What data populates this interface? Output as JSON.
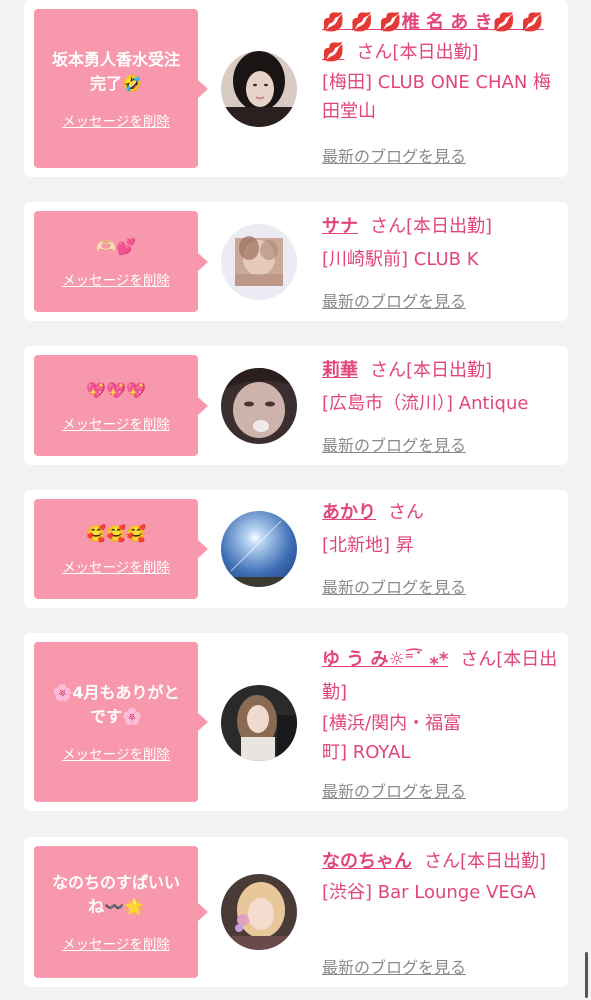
{
  "colors": {
    "accent": "#e2457a",
    "bubble": "#f898ad",
    "background": "#f2f2f4",
    "link_gray": "#8a8a8a"
  },
  "messages": [
    {
      "message": "坂本勇人香水受注完了🤣",
      "delete_label": "メッセージを削除",
      "name": "💋 💋 💋椎 名 あ き💋 💋 💋",
      "suffix": "さん[本日出勤]",
      "shop": "[梅田] CLUB ONE CHAN 梅田堂山",
      "blog_label": "最新のブログを見る",
      "avatar": "avatar-woman-dark-hair"
    },
    {
      "message": "🫶🏻💕",
      "delete_label": "メッセージを削除",
      "name": "サナ",
      "suffix": "さん[本日出勤]",
      "shop": "[川崎駅前] CLUB K",
      "blog_label": "最新のブログを見る",
      "avatar": "avatar-blurred-photo"
    },
    {
      "message": "💖💖💖",
      "delete_label": "メッセージを削除",
      "name": "莉華",
      "suffix": "さん[本日出勤]",
      "shop": "[広島市（流川）] Antique",
      "blog_label": "最新のブログを見る",
      "avatar": "avatar-woman-closeup"
    },
    {
      "message": "🥰🥰🥰",
      "delete_label": "メッセージを削除",
      "name": "あかり",
      "suffix": "さん",
      "shop": "[北新地] 昇",
      "blog_label": "最新のブログを見る",
      "avatar": "avatar-sky-sun"
    },
    {
      "message": "🌸4月もありがとです🌸",
      "delete_label": "メッセージを削除",
      "name": "ゆ う み☼⁼͡˙ ⁎*",
      "suffix": "さん[本日出勤]",
      "shop": "[横浜/関内・福富町] ROYAL",
      "blog_label": "最新のブログを見る",
      "avatar": "avatar-woman-long-hair"
    },
    {
      "message": "なのちのすぱいいね〰️🌟",
      "delete_label": "メッセージを削除",
      "name": "なのちゃん",
      "suffix": "さん[本日出勤]",
      "shop": "[渋谷] Bar Lounge VEGA",
      "blog_label": "最新のブログを見る",
      "avatar": "avatar-woman-blonde"
    }
  ]
}
